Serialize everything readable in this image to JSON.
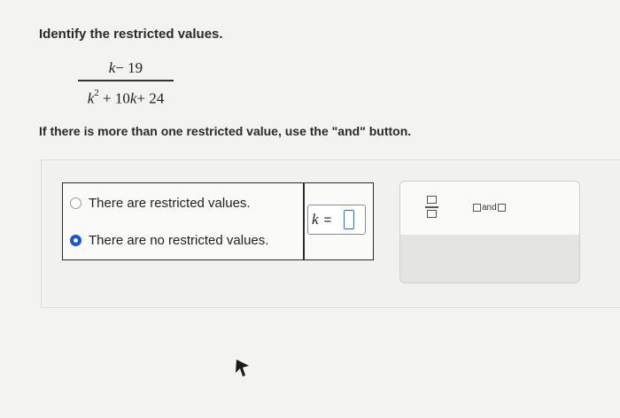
{
  "question": {
    "prompt": "Identify the restricted values.",
    "fraction": {
      "numerator_var": "k",
      "numerator_rest": "− 19",
      "denominator_var": "k",
      "denominator_exp": "2",
      "denominator_mid": " + 10",
      "denominator_var2": "k",
      "denominator_end": "+ 24"
    },
    "hint": "If there is more than one restricted value, use the \"and\" button."
  },
  "choices": [
    {
      "label": "There are restricted values.",
      "selected": false
    },
    {
      "label": "There are no restricted values.",
      "selected": true
    }
  ],
  "answer_box": {
    "variable": "k",
    "equals": "="
  },
  "palette": {
    "fraction_icon": "fraction-template-icon",
    "and_label": "and",
    "clear_symbol": "×",
    "undo_icon": "undo-icon"
  },
  "colors": {
    "accent": "#1756d8",
    "input_slot": "#1a73e8"
  }
}
